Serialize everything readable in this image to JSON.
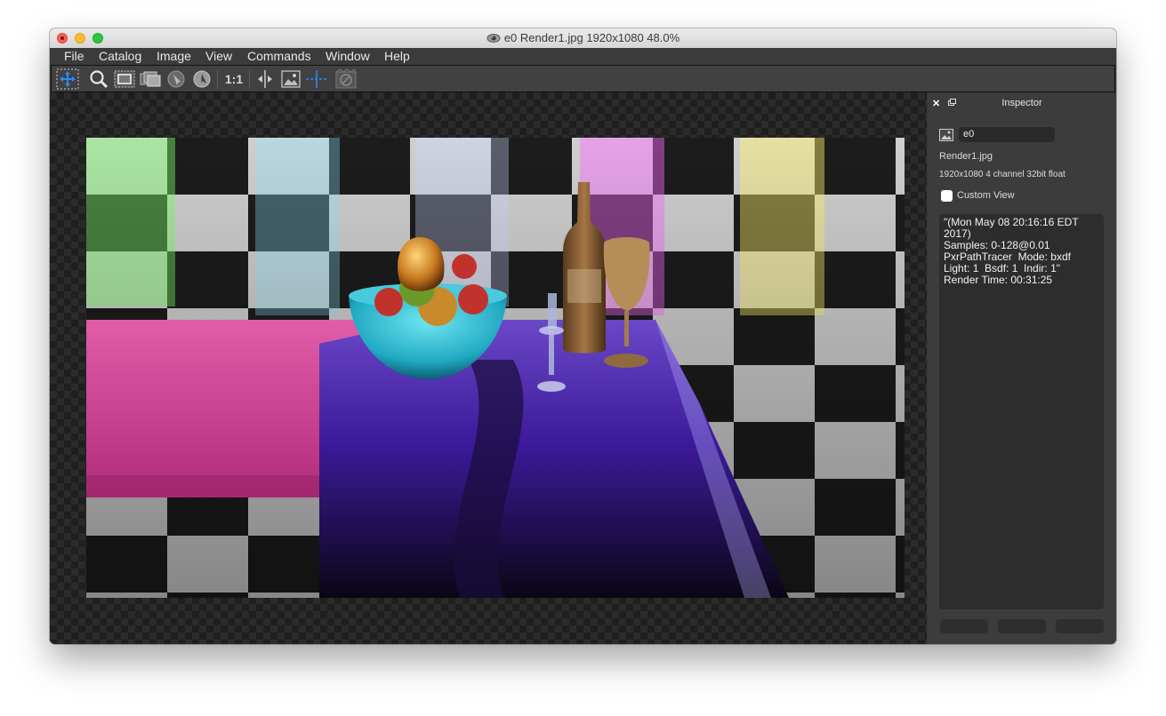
{
  "window": {
    "title": "e0 Render1.jpg 1920x1080 48.0%",
    "title_icon": "eye-icon"
  },
  "menu": [
    "File",
    "Catalog",
    "Image",
    "View",
    "Commands",
    "Window",
    "Help"
  ],
  "toolbar": {
    "items": [
      {
        "name": "pan-tool-icon",
        "label": ""
      },
      {
        "name": "zoom-tool-icon",
        "label": ""
      },
      {
        "name": "crop-region-icon",
        "label": ""
      },
      {
        "name": "channel-select-icon",
        "label": ""
      },
      {
        "name": "pick-color-icon",
        "label": ""
      },
      {
        "name": "rotate-view-icon",
        "label": ""
      },
      {
        "name": "actual-size-button",
        "label": "1:1"
      },
      {
        "name": "split-compare-icon",
        "label": ""
      },
      {
        "name": "image-fit-icon",
        "label": ""
      },
      {
        "name": "crosshair-icon",
        "label": ""
      },
      {
        "name": "stop-render-icon",
        "label": ""
      }
    ],
    "active_color": "#2a8cff"
  },
  "inspector": {
    "title": "Inspector",
    "image_name": "e0",
    "file_name": "Render1.jpg",
    "image_info": "1920x1080 4 channel 32bit float",
    "custom_view_label": "Custom View",
    "custom_view_checked": false,
    "notes": "\"(Mon May 08 20:16:16 EDT 2017)\nSamples: 0-128@0.01\nPxrPathTracer  Mode: bxdf\nLight: 1  Bsdf: 1  Indir: 1\"\nRender Time: 00:31:25"
  },
  "colors": {
    "window_bg": "#3a3a3a",
    "checker_dark": "#1f1f1f",
    "checker_light": "#2b2b2b",
    "accent": "#2a8cff"
  }
}
